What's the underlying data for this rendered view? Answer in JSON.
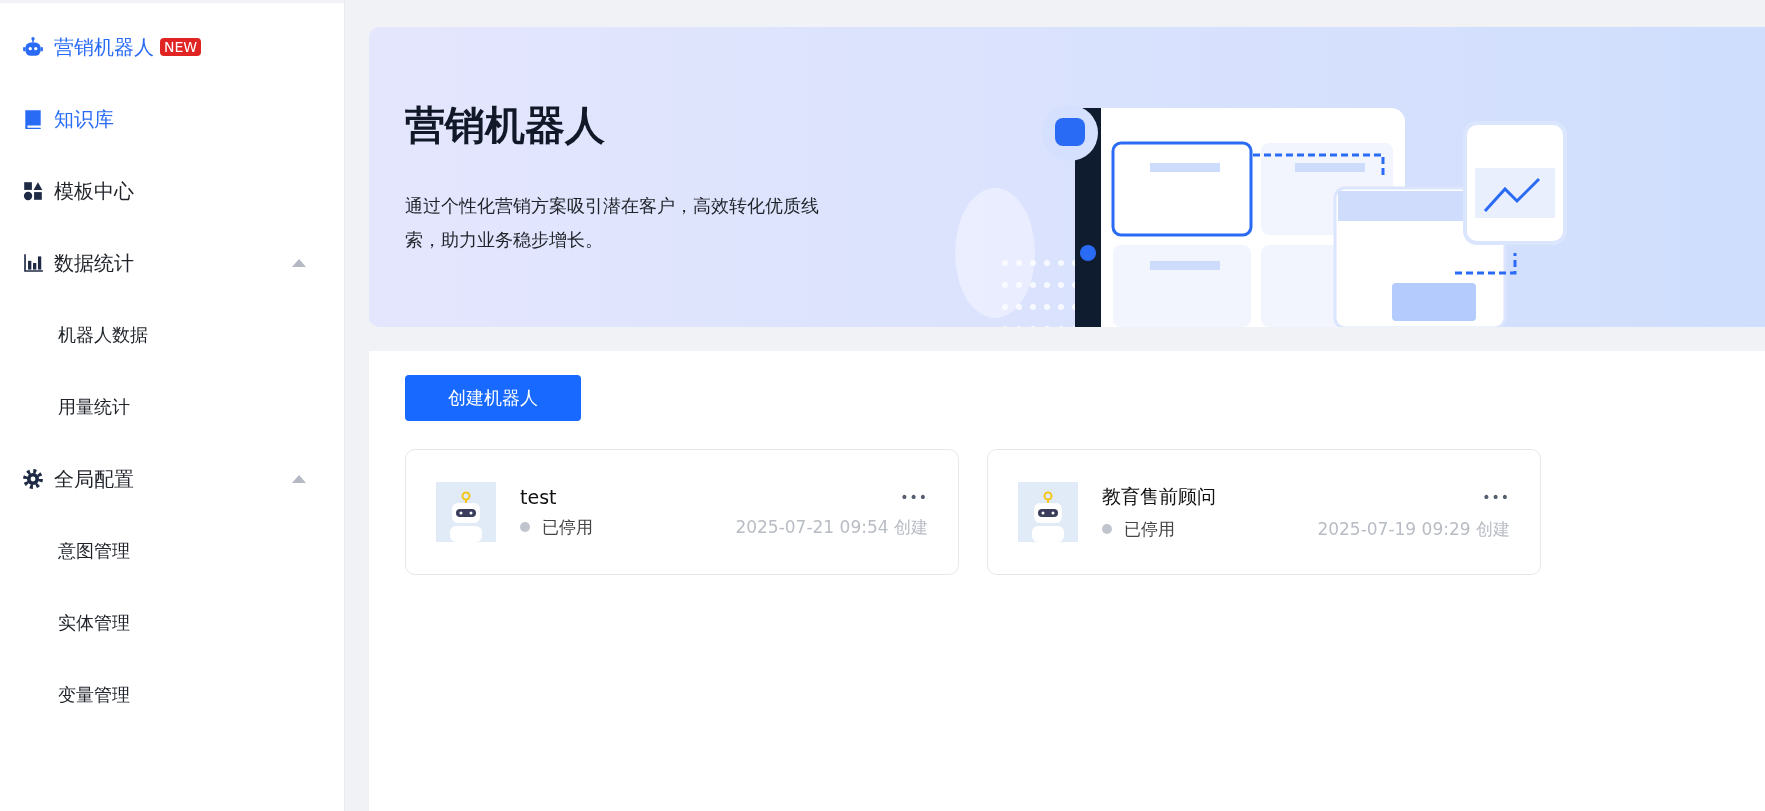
{
  "sidebar": {
    "items": [
      {
        "label": "营销机器人",
        "badge": "NEW",
        "selected": true
      },
      {
        "label": "知识库",
        "selected": true
      },
      {
        "label": "模板中心",
        "selected": false
      },
      {
        "label": "数据统计",
        "selected": false,
        "expanded": true,
        "children": [
          {
            "label": "机器人数据",
            "selected": false
          },
          {
            "label": "用量统计",
            "selected": false
          }
        ]
      },
      {
        "label": "全局配置",
        "selected": false,
        "expanded": true,
        "children": [
          {
            "label": "意图管理",
            "selected": false
          },
          {
            "label": "实体管理",
            "selected": false
          },
          {
            "label": "变量管理",
            "selected": false
          }
        ]
      }
    ]
  },
  "banner": {
    "title": "营销机器人",
    "description": "通过个性化营销方案吸引潜在客户，高效转化优质线索，助力业务稳步增长。"
  },
  "create_button": "创建机器人",
  "bots": [
    {
      "name": "test",
      "status": "已停用",
      "enabled": false,
      "created": "2025-07-21 09:54 创建",
      "menu": "•••"
    },
    {
      "name": "教育售前顾问",
      "status": "已停用",
      "enabled": false,
      "created": "2025-07-19 09:29 创建",
      "menu": "•••"
    }
  ]
}
